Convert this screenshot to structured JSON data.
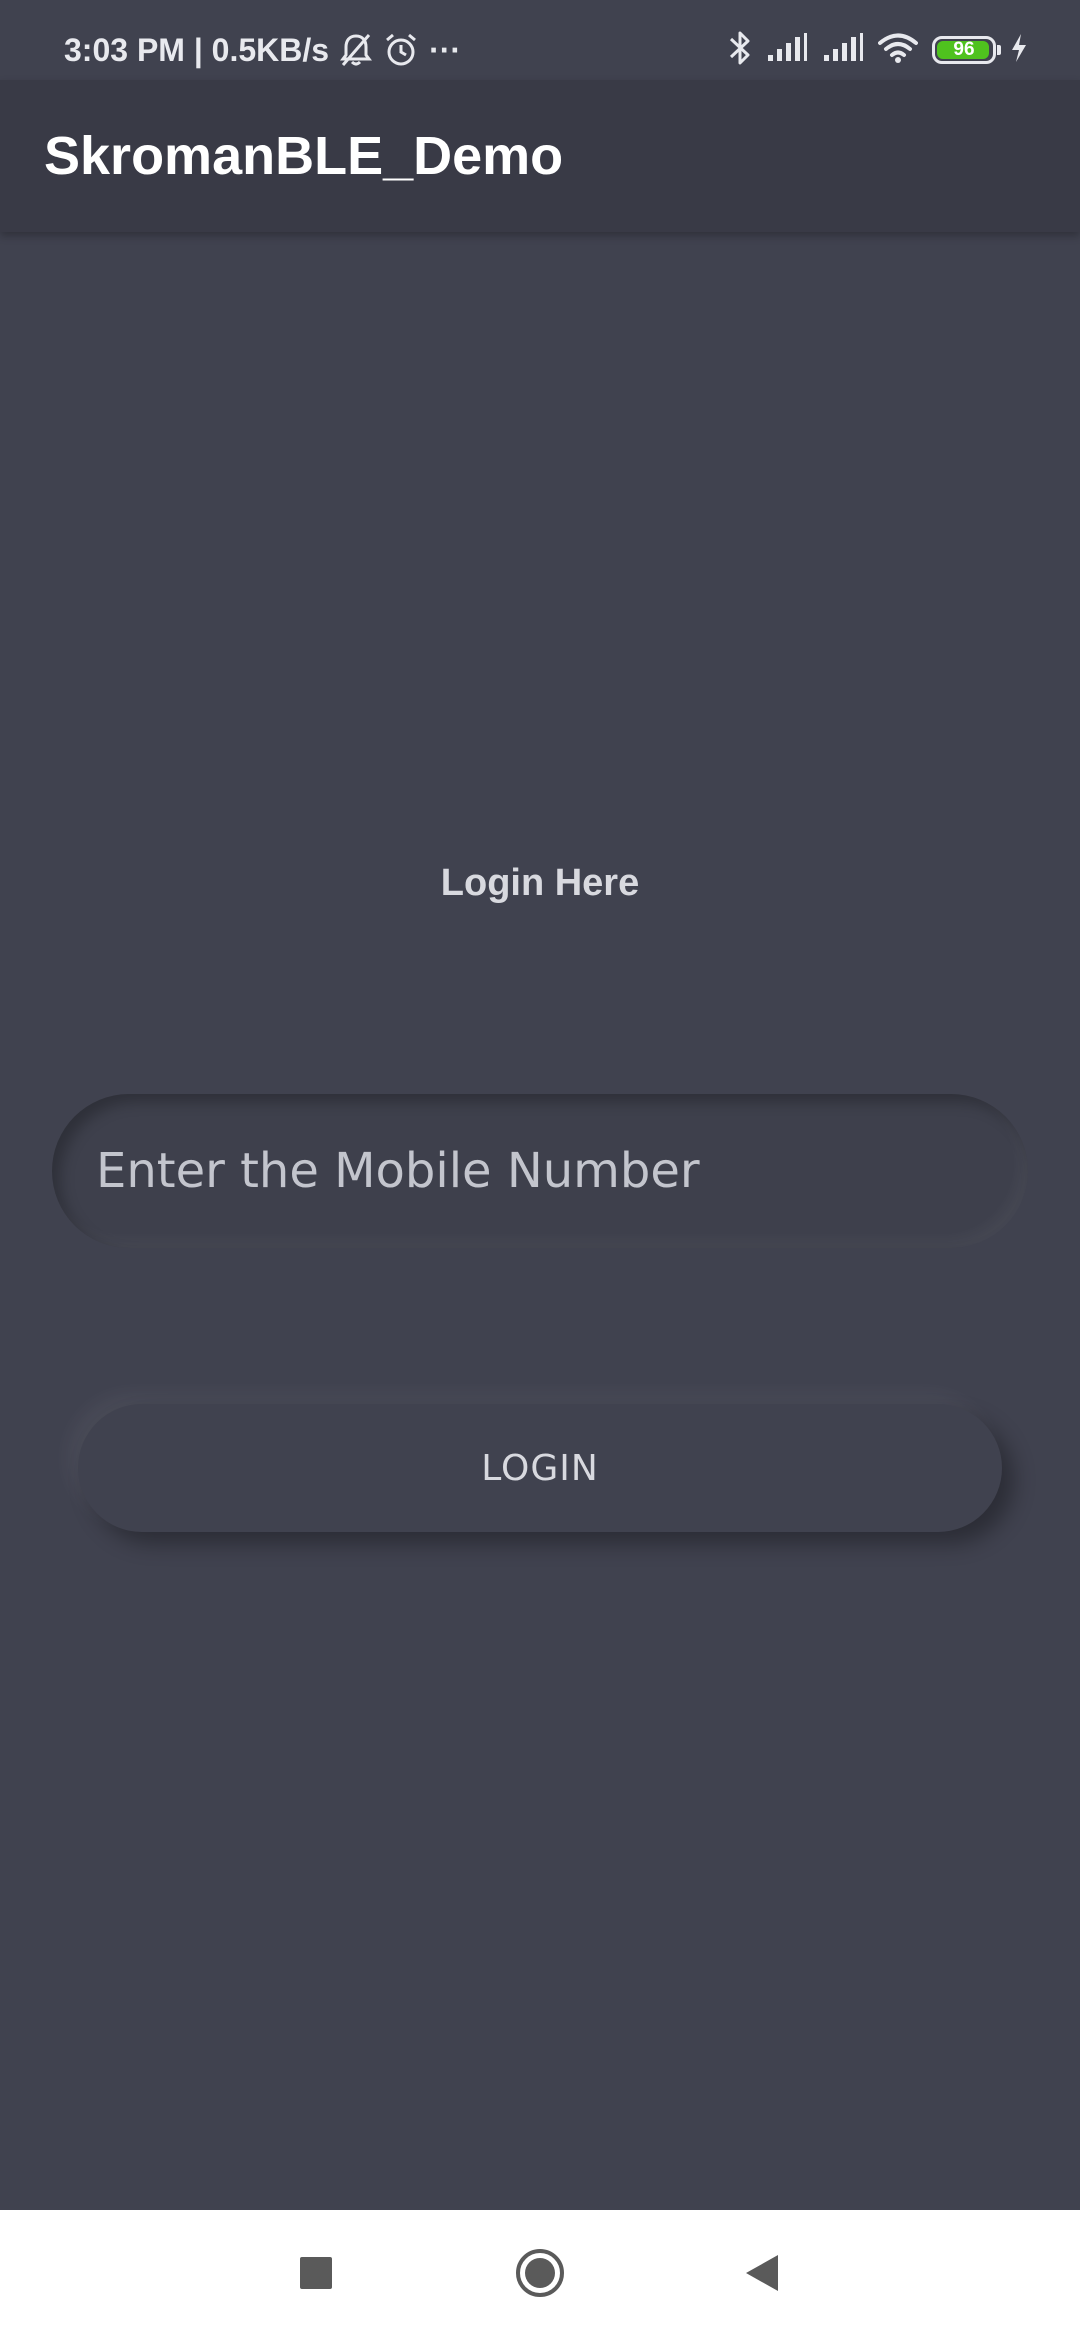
{
  "status_bar": {
    "time_speed": "3:03 PM | 0.5KB/s",
    "more_dots": "···",
    "battery_level": "96",
    "battery_fraction": 0.96,
    "battery_color": "#4fc21e",
    "icons": [
      "mute-bell-icon",
      "alarm-icon",
      "more-icon",
      "bluetooth-icon",
      "signal-icon",
      "signal-icon",
      "wifi-icon",
      "battery-icon",
      "charging-icon"
    ]
  },
  "app_bar": {
    "title": "SkromanBLE_Demo"
  },
  "login": {
    "heading": "Login Here",
    "mobile_placeholder": "Enter the Mobile Number",
    "mobile_value": "",
    "button_label": "LOGIN"
  },
  "nav_bar": {
    "icons": [
      "recents-icon",
      "home-icon",
      "back-icon"
    ]
  },
  "colors": {
    "background": "#40424f",
    "app_bar": "#393a46",
    "text": "#d8d9df",
    "nav_bar": "#ffffff"
  }
}
